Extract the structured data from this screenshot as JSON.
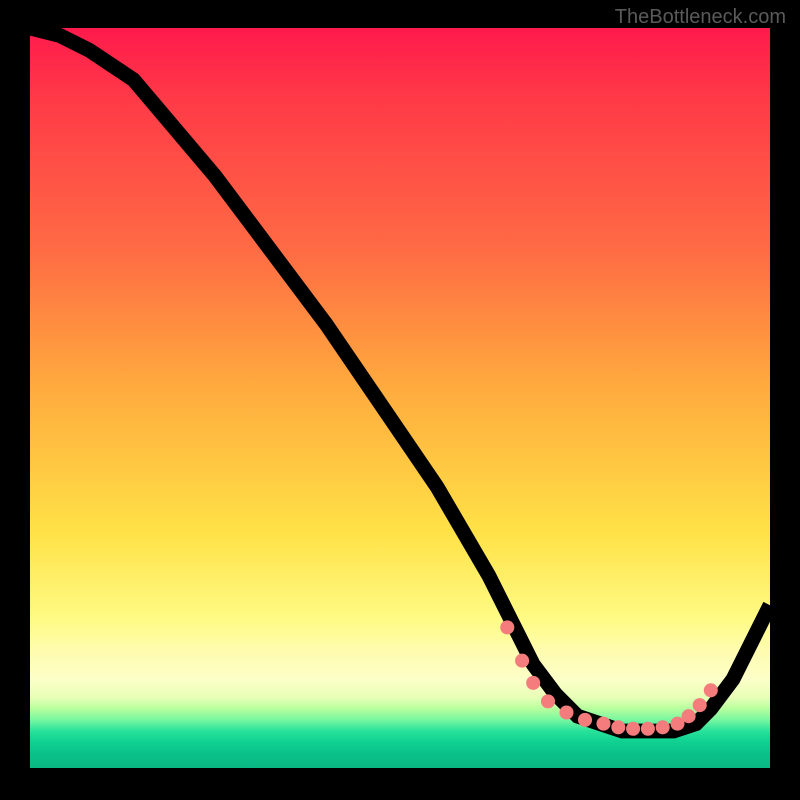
{
  "watermark": "TheBottleneck.com",
  "colors": {
    "dot": "#f47c7c",
    "line": "#000000",
    "background": "#000000"
  },
  "chart_data": {
    "type": "line",
    "title": "",
    "xlabel": "",
    "ylabel": "",
    "xlim": [
      0,
      100
    ],
    "ylim": [
      0,
      100
    ],
    "note": "Values are read in plot-percentage coordinates (0–100 on each axis). The curve is a bottleneck-style V: a steep descent from the top-left, a flat minimum near the bottom-right third, then a rise toward the right edge.",
    "series": [
      {
        "name": "curve",
        "x": [
          0,
          4,
          8,
          14,
          25,
          40,
          55,
          62,
          65,
          68,
          71,
          74,
          77,
          80,
          83,
          87,
          90,
          92,
          95,
          100
        ],
        "y": [
          100,
          99,
          97,
          93,
          80,
          60,
          38,
          26,
          20,
          14,
          10,
          7,
          6,
          5,
          5,
          5,
          6,
          8,
          12,
          22
        ]
      }
    ],
    "markers": {
      "name": "salmon-dots",
      "x": [
        64.5,
        66.5,
        68,
        70,
        72.5,
        75,
        77.5,
        79.5,
        81.5,
        83.5,
        85.5,
        87.5,
        89,
        90.5,
        92
      ],
      "y": [
        19,
        14.5,
        11.5,
        9,
        7.5,
        6.5,
        6,
        5.5,
        5.3,
        5.3,
        5.5,
        6,
        7,
        8.5,
        10.5
      ]
    }
  }
}
